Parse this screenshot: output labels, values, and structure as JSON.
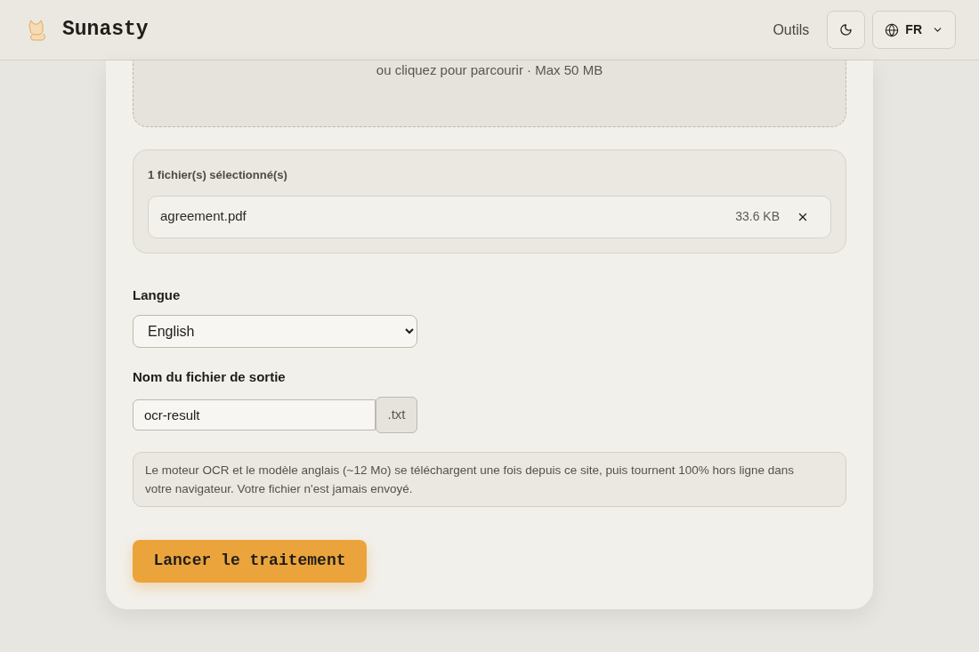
{
  "header": {
    "logo": "Sunasty",
    "nav_link": "Outils",
    "language": "FR"
  },
  "dropzone": {
    "hint": "ou cliquez pour parcourir · Max 50 MB"
  },
  "files": {
    "heading": "1 fichier(s) sélectionné(s)",
    "items": [
      {
        "name": "agreement.pdf",
        "size": "33.6 KB"
      }
    ]
  },
  "language_field": {
    "label": "Langue",
    "value": "English"
  },
  "output_field": {
    "label": "Nom du fichier de sortie",
    "value": "ocr-result",
    "suffix": ".txt"
  },
  "notice": "Le moteur OCR et le modèle anglais (~12 Mo) se téléchargent une fois depuis ce site, puis tournent 100% hors ligne dans votre navigateur. Votre fichier n'est jamais envoyé.",
  "submit": "Lancer le traitement"
}
